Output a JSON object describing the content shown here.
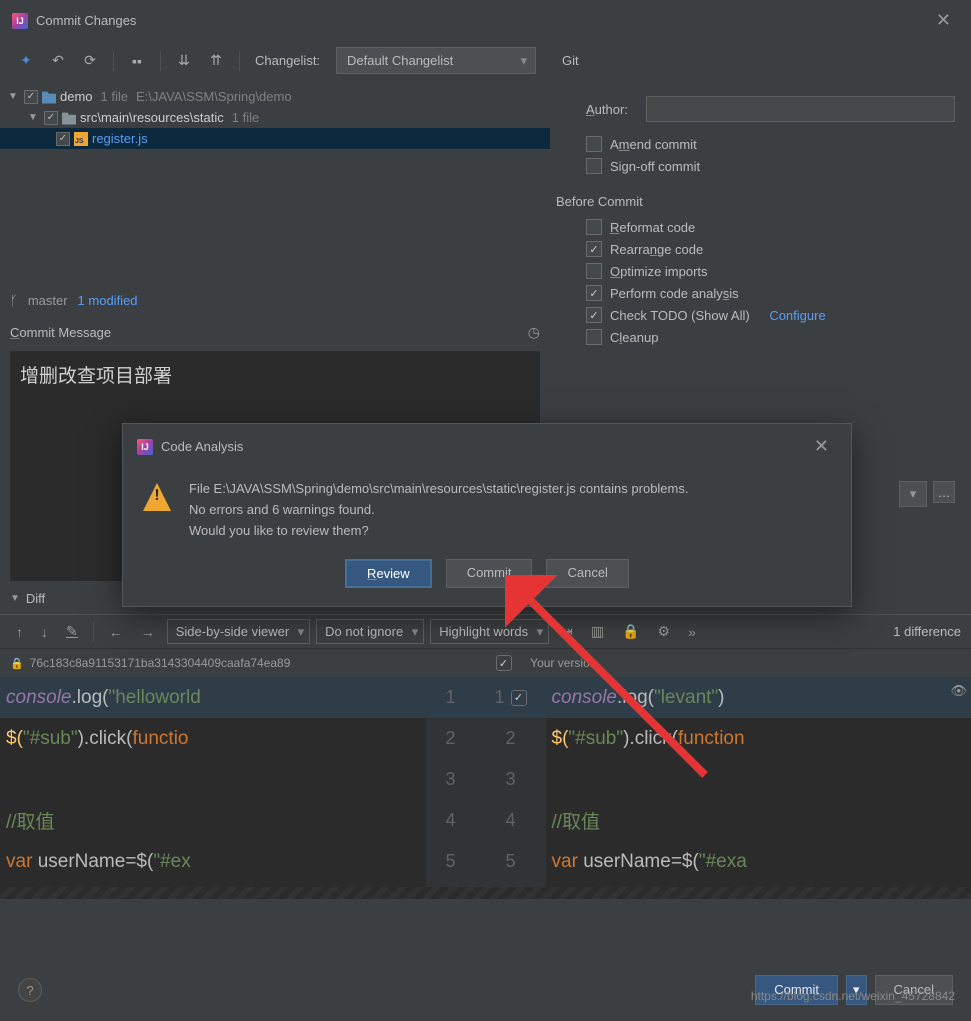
{
  "window": {
    "title": "Commit Changes"
  },
  "toolbar": {
    "changelist_label": "Changelist:",
    "changelist_value": "Default Changelist",
    "git_label": "Git"
  },
  "tree": {
    "root": {
      "name": "demo",
      "meta": "1 file",
      "path": "E:\\JAVA\\SSM\\Spring\\demo"
    },
    "sub": {
      "name": "src\\main\\resources\\static",
      "meta": "1 file"
    },
    "file": {
      "name": "register.js"
    }
  },
  "branch": {
    "name": "master",
    "status": "1 modified"
  },
  "commit": {
    "label": "Commit Message",
    "text": "增删改查项目部署"
  },
  "author": {
    "label": "Author:",
    "value": ""
  },
  "options": {
    "amend": "Amend commit",
    "signoff": "Sign-off commit",
    "before_label": "Before Commit",
    "reformat": "Reformat code",
    "rearrange": "Rearrange code",
    "optimize": "Optimize imports",
    "analysis": "Perform code analysis",
    "todo": "Check TODO (Show All)",
    "configure": "Configure",
    "cleanup": "Cleanup"
  },
  "diff": {
    "label": "Diff",
    "viewer": "Side-by-side viewer",
    "ignore": "Do not ignore",
    "highlight": "Highlight words",
    "count": "1 difference",
    "hash": "76c183c8a91153171ba3143304409caafa74ea89",
    "your": "Your version"
  },
  "code": {
    "left": {
      "l1a": "console",
      "l1b": ".log(",
      "l1c": "\"helloworld",
      "l2a": "$(",
      "l2b": "\"#sub\"",
      "l2c": ").click(",
      "l2d": "functio",
      "l4": "//取值",
      "l5a": "var ",
      "l5b": "userName=$(",
      "l5c": "\"#ex"
    },
    "right": {
      "l1a": "console",
      "l1b": ".log(",
      "l1c": "\"levant\"",
      "l1d": ")",
      "l2a": "$(",
      "l2b": "\"#sub\"",
      "l2c": ").click(",
      "l2d": "function",
      "l4": "//取值",
      "l5a": "var ",
      "l5b": "userName=$(",
      "l5c": "\"#exa"
    }
  },
  "dialog": {
    "title": "Code Analysis",
    "line1": "File E:\\JAVA\\SSM\\Spring\\demo\\src\\main\\resources\\static\\register.js contains problems.",
    "line2": "No errors and 6 warnings found.",
    "line3": "Would you like to review them?",
    "review": "Review",
    "commit": "Commit",
    "cancel": "Cancel"
  },
  "footer": {
    "commit": "Commit",
    "cancel": "Cancel"
  },
  "watermark": "https://blog.csdn.net/weixin_45728842"
}
